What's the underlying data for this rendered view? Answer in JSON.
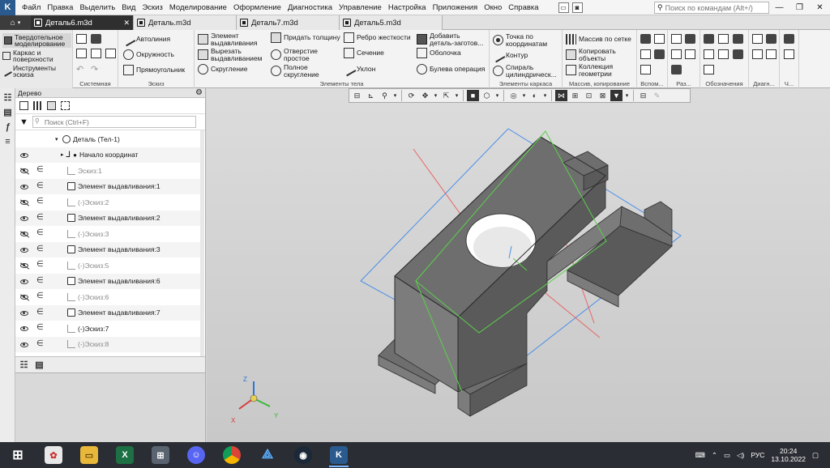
{
  "app": {
    "logo": "K"
  },
  "menu": [
    "Файл",
    "Правка",
    "Выделить",
    "Вид",
    "Эскиз",
    "Моделирование",
    "Оформление",
    "Диагностика",
    "Управление",
    "Настройка",
    "Приложения",
    "Окно",
    "Справка"
  ],
  "command_search": {
    "placeholder": "Поиск по командам (Alt+/)"
  },
  "doc_tabs": [
    {
      "label": "Деталь6.m3d",
      "active": true
    },
    {
      "label": "Деталь.m3d",
      "active": false
    },
    {
      "label": "Деталь7.m3d",
      "active": false
    },
    {
      "label": "Деталь5.m3d",
      "active": false
    }
  ],
  "ribbon": {
    "modes": [
      "Твердотельное моделирование",
      "Каркас и поверхности",
      "Инструменты эскиза"
    ],
    "sketch_tools": [
      "Автолиния",
      "Окружность",
      "Прямоугольник"
    ],
    "body_tools": [
      "Элемент выдавливания",
      "Вырезать выдавливанием",
      "Скругление",
      "Придать толщину",
      "Отверстие простое",
      "Полное скругление",
      "Ребро жесткости",
      "Сечение",
      "Уклон",
      "Добавить деталь-заготов...",
      "Оболочка",
      "Булева операция"
    ],
    "frame_tools": [
      "Точка по координатам",
      "Контур",
      "Спираль цилиндрическ..."
    ],
    "copy_tools": [
      "Массив по сетке",
      "Копировать объекты",
      "Коллекция геометрии"
    ],
    "group_labels": [
      "Системная",
      "Эскиз",
      "Элементы тела",
      "Элементы каркаса",
      "Массив, копирование",
      "Вспом...",
      "Раз...",
      "Обозначения",
      "Диагн...",
      "Ч..."
    ]
  },
  "tree": {
    "title": "Дерево",
    "search_placeholder": "Поиск (Ctrl+F)",
    "root": "Деталь (Тел-1)",
    "rows": [
      {
        "label": "Начало координат",
        "muted": false,
        "type": "origin",
        "eye": "on"
      },
      {
        "label": "Эскиз:1",
        "muted": true,
        "type": "sketch",
        "eye": "off"
      },
      {
        "label": "Элемент выдавливания:1",
        "muted": false,
        "type": "op",
        "eye": "on"
      },
      {
        "label": "(-)Эскиз:2",
        "muted": true,
        "type": "sketch",
        "eye": "off"
      },
      {
        "label": "Элемент выдавливания:2",
        "muted": false,
        "type": "op",
        "eye": "on"
      },
      {
        "label": "(-)Эскиз:3",
        "muted": true,
        "type": "sketch",
        "eye": "off"
      },
      {
        "label": "Элемент выдавливания:3",
        "muted": false,
        "type": "op",
        "eye": "on"
      },
      {
        "label": "(-)Эскиз:5",
        "muted": true,
        "type": "sketch",
        "eye": "off"
      },
      {
        "label": "Элемент выдавливания:6",
        "muted": false,
        "type": "op",
        "eye": "on"
      },
      {
        "label": "(-)Эскиз:6",
        "muted": true,
        "type": "sketch",
        "eye": "off"
      },
      {
        "label": "Элемент выдавливания:7",
        "muted": false,
        "type": "op",
        "eye": "on"
      },
      {
        "label": "(-)Эскиз:7",
        "muted": false,
        "type": "sketch",
        "eye": "on"
      },
      {
        "label": "(-)Эскиз:8",
        "muted": true,
        "type": "sketch",
        "eye": "on"
      }
    ]
  },
  "axes": {
    "x": "X",
    "y": "Y",
    "z": "Z"
  },
  "colors": {
    "plane_blue": "#4a8ee8",
    "plane_red": "#e86464",
    "plane_green": "#5ad04a",
    "model_top": "#6e6e6e",
    "model_side": "#5a5a5a",
    "model_front": "#7c7c7c"
  },
  "taskbar": {
    "apps": [
      "start",
      "paint",
      "explorer",
      "excel",
      "calculator",
      "discord",
      "chrome",
      "app-blue",
      "steam",
      "kompas"
    ],
    "lang": "РУС",
    "time": "20:24",
    "date": "13.10.2022"
  }
}
